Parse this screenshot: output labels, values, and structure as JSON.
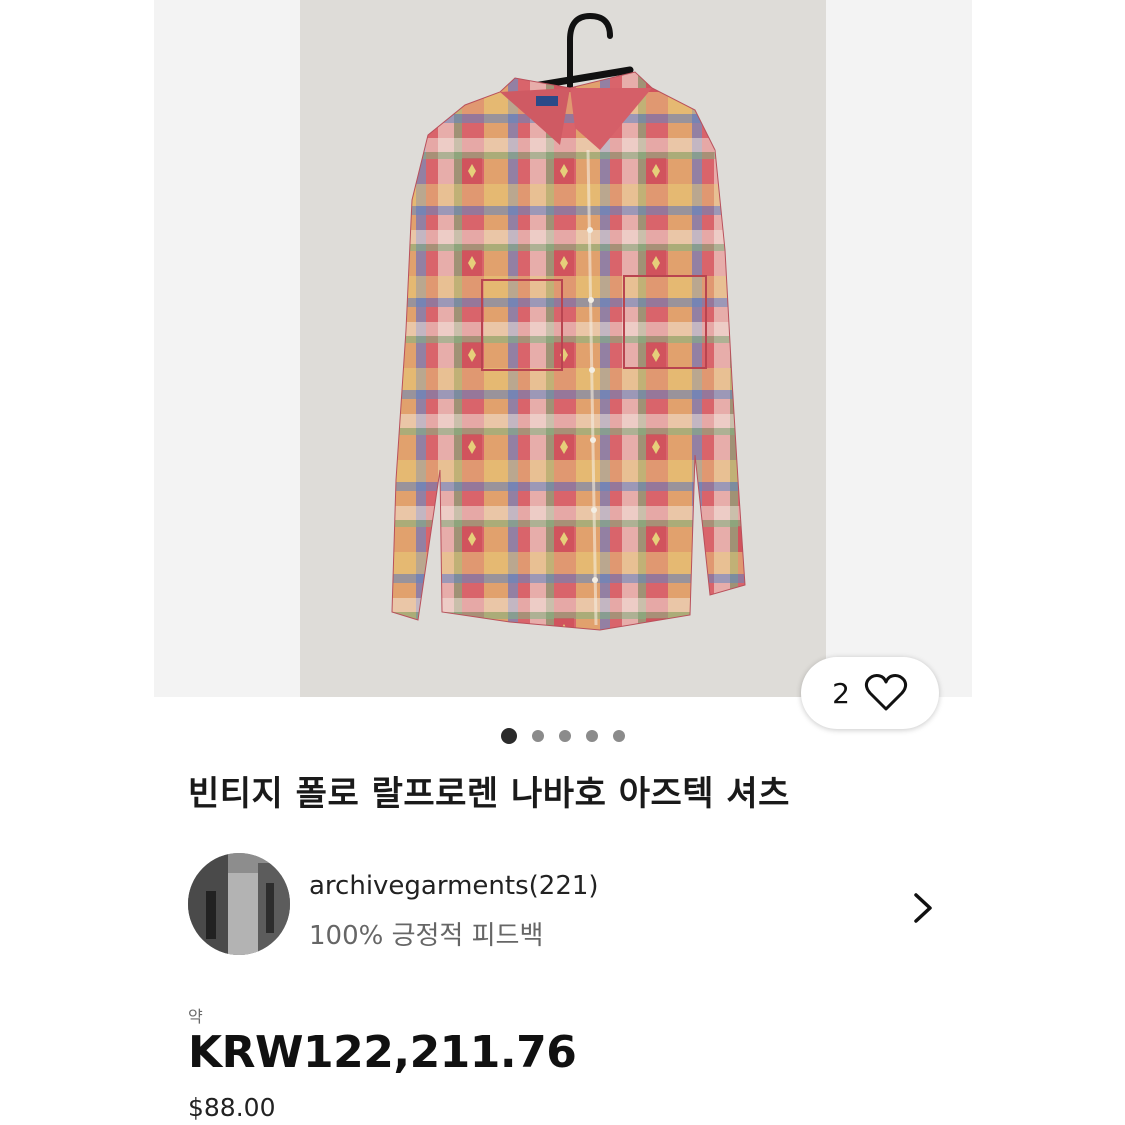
{
  "gallery": {
    "like_count": "2",
    "like_icon": "heart-outline-icon",
    "image_count": 5,
    "active_image": 1,
    "background": "#f3f3f3",
    "photo_background": "#dedcd8"
  },
  "listing": {
    "title": "빈티지 폴로 랄프로렌 나바호 아즈텍 셔츠"
  },
  "seller": {
    "name": "archivegarments(221)",
    "feedback": "100% 긍정적 피드백",
    "chevron_icon": "chevron-right-icon"
  },
  "pricing": {
    "approx_label": "약",
    "price_krw": "KRW122,211.76",
    "price_usd": "$88.00"
  },
  "colors": {
    "text": "#111111",
    "muted": "#666666",
    "dot_active": "#2b2b2b",
    "dot_inactive": "#8b8b8b"
  }
}
